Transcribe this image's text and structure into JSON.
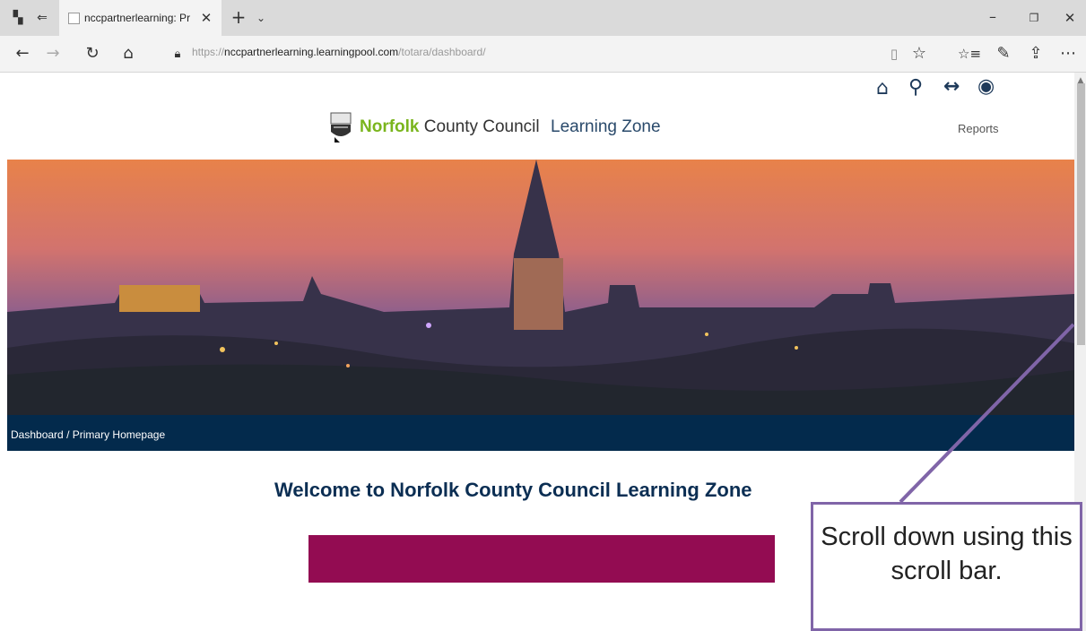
{
  "browser": {
    "tab_title": "nccpartnerlearning: Prin",
    "url_scheme": "https://",
    "url_host": "nccpartnerlearning.learningpool.com",
    "url_path": "/totara/dashboard/",
    "icons": [
      "tab-actions-icon",
      "tab-set-aside-icon",
      "favicon-icon",
      "close-tab-icon",
      "new-tab-icon",
      "tab-preview-icon",
      "minimize-icon",
      "restore-icon",
      "close-window-icon",
      "back-icon",
      "forward-icon",
      "refresh-icon",
      "home-icon",
      "lock-icon",
      "reading-view-icon",
      "favorite-star-icon",
      "favorites-list-icon",
      "notes-icon",
      "share-icon",
      "more-icon"
    ]
  },
  "header": {
    "brand_norfolk": "Norfolk",
    "brand_rest": " County Council",
    "brand_zone": "Learning Zone",
    "reports_link": "Reports",
    "nav_icons": [
      "home-icon",
      "search-icon",
      "swap-icon",
      "user-icon"
    ]
  },
  "breadcrumb": {
    "items": [
      "Dashboard",
      "Primary Homepage"
    ],
    "separator": "/"
  },
  "main": {
    "welcome_title": "Welcome to Norfolk County Council Learning Zone",
    "banner_color": "#930c52"
  },
  "annotation": {
    "callout_text": "Scroll down using this scroll bar.",
    "border_color": "#8065a8"
  },
  "colors": {
    "nav_dark": "#032a4c",
    "brand_green": "#7ab51d",
    "accent_magenta": "#930c52"
  }
}
